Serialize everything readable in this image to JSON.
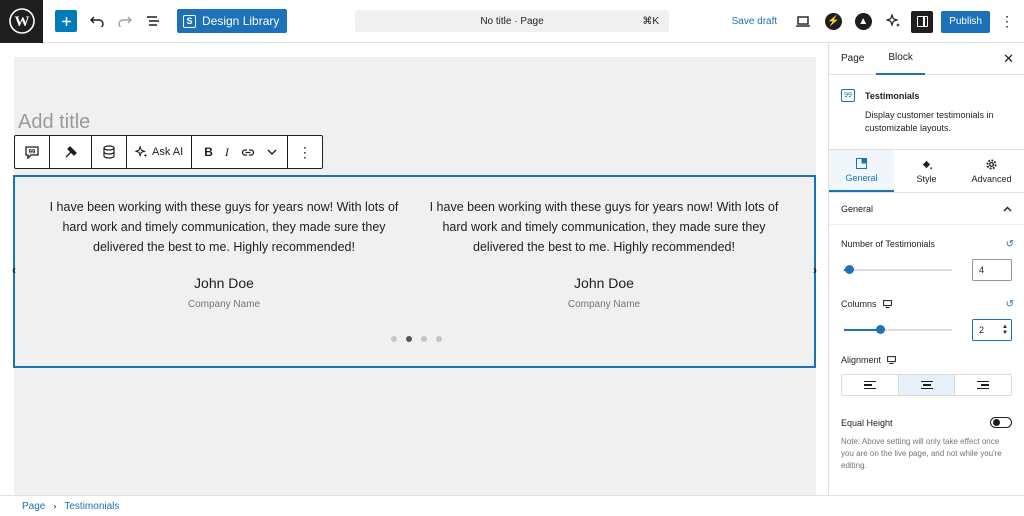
{
  "topbar": {
    "design_library_label": "Design Library",
    "doc_title": "No title · Page",
    "shortcut": "⌘K",
    "save_draft": "Save draft",
    "publish": "Publish"
  },
  "editor": {
    "title_placeholder": "Add title",
    "toolbar": {
      "ask_ai": "Ask AI",
      "bold": "B",
      "italic": "I"
    }
  },
  "testimonials": {
    "items": [
      {
        "quote": "I have been working with these guys for years now! With lots of hard work and timely communication, they made sure they delivered the best to me. Highly recommended!",
        "name": "John Doe",
        "company": "Company Name"
      },
      {
        "quote": "I have been working with these guys for years now! With lots of hard work and timely communication, they made sure they delivered the best to me. Highly recommended!",
        "name": "John Doe",
        "company": "Company Name"
      }
    ],
    "dot_count": 4,
    "active_dot": 1
  },
  "sidebar": {
    "tabs": [
      "Page",
      "Block"
    ],
    "active_tab": "Block",
    "block_title": "Testimonials",
    "block_desc": "Display customer testimonials in customizable layouts.",
    "sub_tabs": [
      "General",
      "Style",
      "Advanced"
    ],
    "panel_title": "General",
    "number_label": "Number of Testimonials",
    "number_value": "4",
    "number_level": 0.05,
    "columns_label": "Columns",
    "columns_value": "2",
    "columns_level": 0.33,
    "alignment_label": "Alignment",
    "alignment_active": "center",
    "equal_height_label": "Equal Height",
    "note": "Note: Above setting will only take effect once you are on the live page, and not while you're editing."
  },
  "breadcrumb": {
    "root": "Page",
    "current": "Testimonials"
  },
  "colors": {
    "accent": "#1c71b8",
    "canvas": "#f0f0f0"
  }
}
